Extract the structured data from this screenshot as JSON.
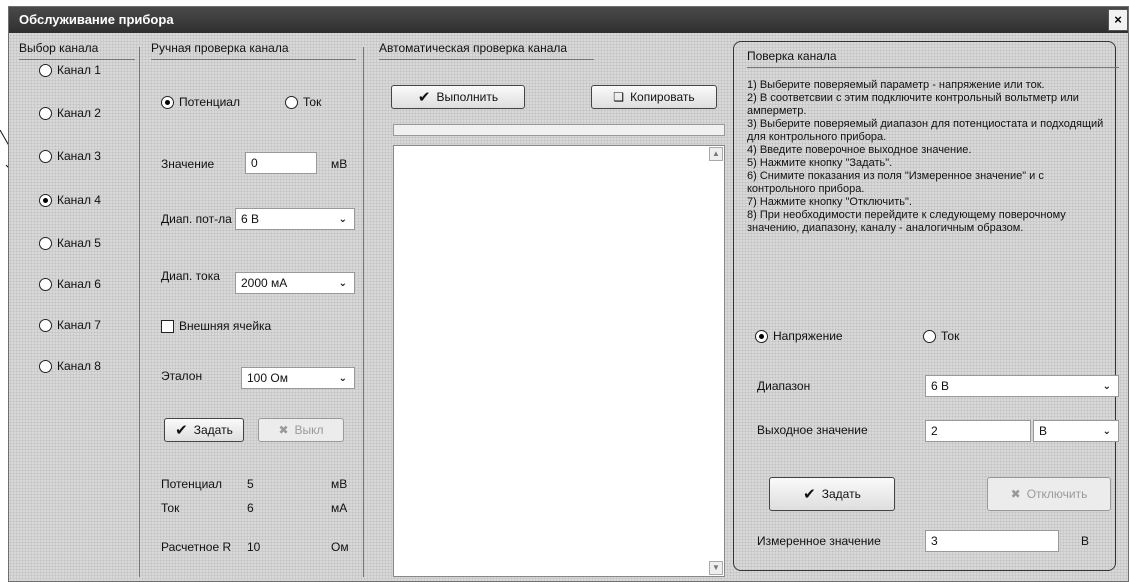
{
  "window": {
    "title": "Обслуживание прибора",
    "close_label": "×"
  },
  "channel_select": {
    "title": "Выбор канала",
    "channels": [
      "Канал 1",
      "Канал 2",
      "Канал 3",
      "Канал 4",
      "Канал 5",
      "Канал 6",
      "Канал 7",
      "Канал 8"
    ],
    "selected_index": 3
  },
  "manual": {
    "title": "Ручная проверка канала",
    "mode_potential": "Потенциал",
    "mode_current": "Ток",
    "value_label": "Значение",
    "value": "0",
    "value_unit": "мВ",
    "pot_range_label": "Диап. пот-ла",
    "pot_range_value": "6 В",
    "cur_range_label": "Диап. тока",
    "cur_range_value": "2000 мА",
    "external_cell_label": "Внешняя ячейка",
    "etalon_label": "Эталон",
    "etalon_value": "100 Ом",
    "set_button": "Задать",
    "off_button": "Выкл",
    "potential_label": "Потенциал",
    "potential_value": "5",
    "potential_unit": "мВ",
    "current_label": "Ток",
    "current_value": "6",
    "current_unit": "мА",
    "calc_r_label": "Расчетное R",
    "calc_r_value": "10",
    "calc_r_unit": "Ом"
  },
  "auto": {
    "title": "Автоматическая проверка канала",
    "run_button": "Выполнить",
    "copy_button": "Копировать"
  },
  "verify": {
    "title": "Поверка канала",
    "instructions": [
      "1) Выберите поверяемый параметр - напряжение или ток.",
      "2) В соответсвии с этим подключите контрольный вольтметр или амперметр.",
      "3) Выберите поверяемый диапазон для потенциостата и подходящий для контрольного прибора.",
      "4) Введите поверочное выходное значение.",
      "5) Нажмите кнопку \"Задать\".",
      "6) Снимите показания из поля \"Измеренное значение\" и с контрольного прибора.",
      "7) Нажмите кнопку \"Отключить\".",
      "8) При необходимости перейдите к следующему поверочному значению, диапазону, каналу - аналогичным образом."
    ],
    "mode_voltage": "Напряжение",
    "mode_current": "Ток",
    "range_label": "Диапазон",
    "range_value": "6 В",
    "output_label": "Выходное значение",
    "output_value": "2",
    "output_unit_value": "В",
    "set_button": "Задать",
    "off_button": "Отключить",
    "measured_label": "Измеренное значение",
    "measured_value": "3",
    "measured_unit": "В"
  }
}
